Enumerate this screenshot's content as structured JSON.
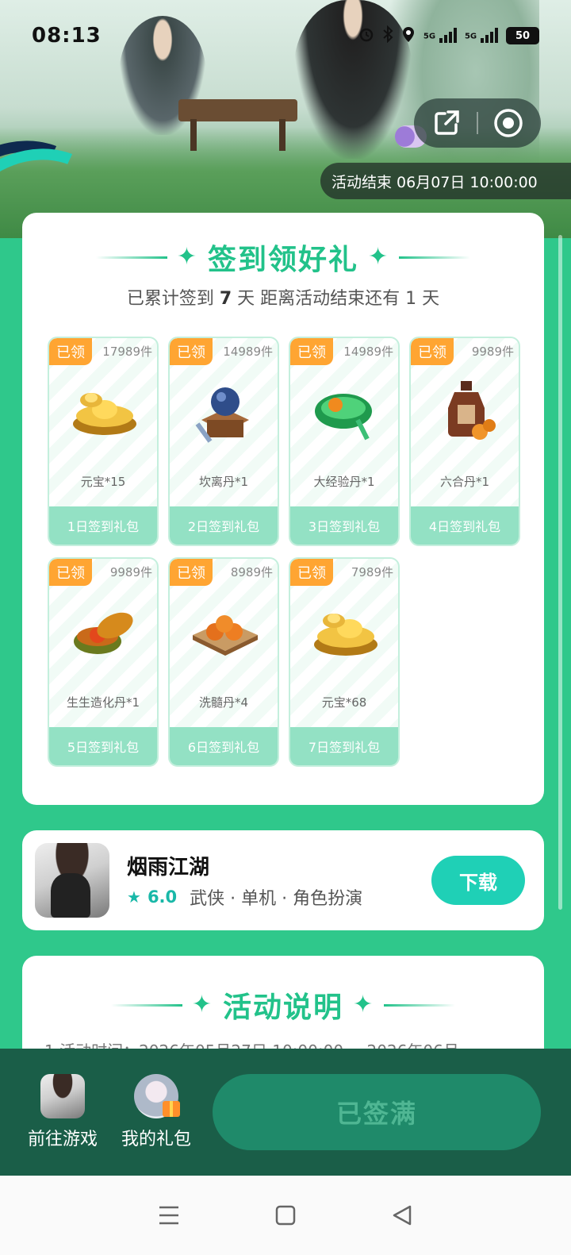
{
  "status_bar": {
    "time": "08:13",
    "net1": "5G",
    "net2": "5G",
    "battery": "50"
  },
  "hero": {
    "end_time": "活动结束 06月07日 10:00:00"
  },
  "checkin": {
    "title": "签到领好礼",
    "sub_prefix": "已累计签到",
    "days_signed": "7",
    "sub_mid": "天 距离活动结束还有",
    "days_left": "1",
    "sub_suffix": "天",
    "gifts": [
      {
        "badge": "已领",
        "count": "17989件",
        "name": "元宝*15",
        "day": "1日签到礼包",
        "icon": "gold-ingot-icon"
      },
      {
        "badge": "已领",
        "count": "14989件",
        "name": "坎离丹*1",
        "day": "2日签到礼包",
        "icon": "pill-stand-icon"
      },
      {
        "badge": "已领",
        "count": "14989件",
        "name": "大经验丹*1",
        "day": "3日签到礼包",
        "icon": "jade-pill-icon"
      },
      {
        "badge": "已领",
        "count": "9989件",
        "name": "六合丹*1",
        "day": "4日签到礼包",
        "icon": "medicine-bottle-icon"
      },
      {
        "badge": "已领",
        "count": "9989件",
        "name": "生生造化丹*1",
        "day": "5日签到礼包",
        "icon": "pill-box-icon"
      },
      {
        "badge": "已领",
        "count": "8989件",
        "name": "洗髓丹*4",
        "day": "6日签到礼包",
        "icon": "pill-plate-icon"
      },
      {
        "badge": "已领",
        "count": "7989件",
        "name": "元宝*68",
        "day": "7日签到礼包",
        "icon": "gold-ingot-icon"
      }
    ]
  },
  "game": {
    "name": "烟雨江湖",
    "rating": "6.0",
    "tags": "武侠 · 单机 · 角色扮演",
    "download_label": "下载"
  },
  "rules": {
    "title": "活动说明",
    "line1": "1.活动时间：2026年05月27日 10:00:00 ~ 2026年06月"
  },
  "bottom_bar": {
    "goto_game_label": "前往游戏",
    "my_gifts_label": "我的礼包",
    "signed_label": "已签满"
  },
  "colors": {
    "accent": "#22c28a",
    "badge": "#ffa532",
    "download": "#1fd0b6",
    "bottom_bar": "#1a5e48"
  }
}
